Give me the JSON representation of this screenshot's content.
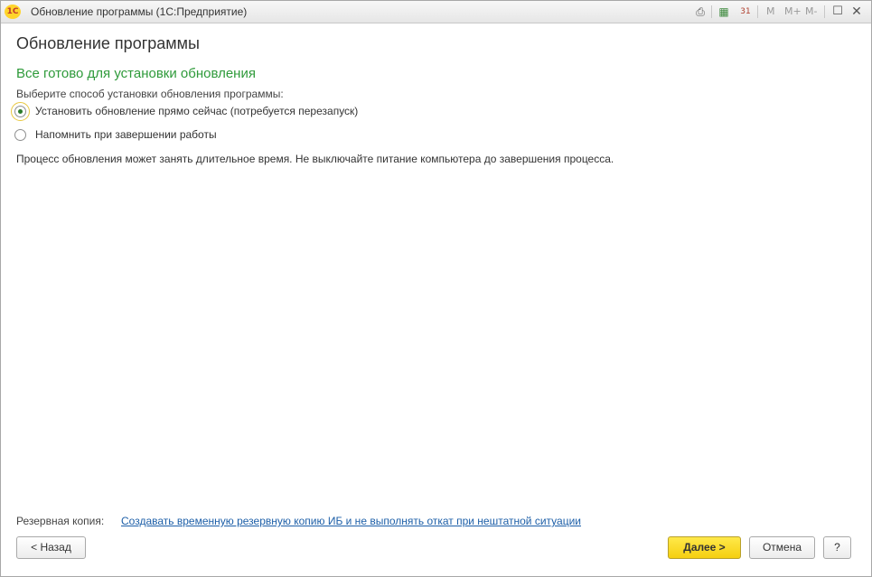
{
  "window": {
    "title": "Обновление программы  (1С:Предприятие)",
    "logo_text": "1С",
    "toolbar": {
      "mem_m": "M",
      "mem_m_plus": "M+",
      "mem_m_minus": "M-"
    }
  },
  "page": {
    "title": "Обновление программы",
    "section_title": "Все готово для установки обновления",
    "instruction": "Выберите способ установки обновления программы:",
    "options": [
      {
        "label": "Установить обновление прямо сейчас (потребуется перезапуск)",
        "selected": true
      },
      {
        "label": "Напомнить при завершении работы",
        "selected": false
      }
    ],
    "warning": "Процесс обновления может занять длительное время. Не выключайте питание компьютера до завершения процесса."
  },
  "backup": {
    "label": "Резервная копия:",
    "link": "Создавать временную резервную копию ИБ и не выполнять откат при нештатной ситуации"
  },
  "buttons": {
    "back": "< Назад",
    "next": "Далее >",
    "cancel": "Отмена",
    "help": "?"
  },
  "colors": {
    "section_title": "#2e9a3a",
    "link": "#1d5fa8",
    "primary_button": "#f5cf10"
  }
}
